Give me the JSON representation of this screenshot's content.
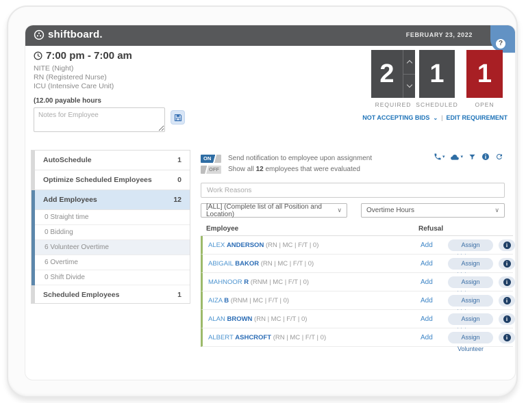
{
  "topbar": {
    "logo_text": "shiftboard.",
    "date": "FEBRUARY 23, 2022",
    "help_label": "?"
  },
  "shift": {
    "time_range": "7:00 pm - 7:00 am",
    "shift_type": "NITE (Night)",
    "position": "RN (Registered Nurse)",
    "unit": "ICU (Intensive Care Unit)",
    "payable_hours": "(12.00 payable hours",
    "notes_placeholder": "Notes for Employee"
  },
  "counters": {
    "required": {
      "value": "2",
      "label": "REQUIRED"
    },
    "scheduled": {
      "value": "1",
      "label": "SCHEDULED"
    },
    "open": {
      "value": "1",
      "label": "OPEN"
    },
    "bids_link": "NOT ACCEPTING BIDS",
    "bids_caret": "⌄",
    "separator": "|",
    "edit_link": "EDIT REQUIREMENT"
  },
  "sidebar": {
    "items": [
      {
        "label": "AutoSchedule",
        "count": "1"
      },
      {
        "label": "Optimize Scheduled Employees",
        "count": "0"
      },
      {
        "label": "Add Employees",
        "count": "12"
      }
    ],
    "subitems": [
      {
        "label": "0 Straight time",
        "highlight": false
      },
      {
        "label": "0 Bidding",
        "highlight": false
      },
      {
        "label": "6 Volunteer Overtime",
        "highlight": true
      },
      {
        "label": "6 Overtime",
        "highlight": false
      },
      {
        "label": "0 Shift Divide",
        "highlight": false
      }
    ],
    "footer": {
      "label": "Scheduled Employees",
      "count": "1"
    }
  },
  "panel": {
    "toggle_on_label": "ON",
    "toggle_off_label": "OFF",
    "notify_text": "Send notification to employee upon assignment",
    "show_prefix": "Show all ",
    "show_count": "12",
    "show_suffix": " employees that were evaluated",
    "caret": "▾",
    "work_reasons_placeholder": "Work Reasons",
    "position_filter": "[ALL] (Complete list of all Position and Location)",
    "overtime_filter": "Overtime Hours",
    "select_caret": "∨",
    "table": {
      "col_employee": "Employee",
      "col_refusal": "Refusal",
      "add_label": "Add",
      "assign_label": "Assign Volunteer",
      "info_label": "i",
      "rows": [
        {
          "first": "ALEX ",
          "last": "ANDERSON ",
          "details": "(RN | MC | F/T | 0)"
        },
        {
          "first": "ABIGAIL ",
          "last": "BAKOR ",
          "details": "(RN | MC | F/T | 0)"
        },
        {
          "first": "MAHNOOR ",
          "last": "R ",
          "details": "(RNM | MC | F/T | 0)"
        },
        {
          "first": "AIZA ",
          "last": "B ",
          "details": "(RNM | MC | F/T | 0)"
        },
        {
          "first": "ALAN ",
          "last": "BROWN ",
          "details": "(RN | MC | F/T | 0)"
        },
        {
          "first": "ALBERT ",
          "last": "ASHCROFT ",
          "details": "(RN | MC | F/T | 0)"
        }
      ]
    }
  },
  "colors": {
    "topbar": "#57585A",
    "counter_dark": "#4A4B4D",
    "counter_red": "#A81F24",
    "link_blue": "#1E73B8",
    "icon_blue": "#2E6DA4",
    "active_item_bg": "#D7E6F4",
    "row_green": "#9CBA6A",
    "pill_bg": "#E3E9F1",
    "info_navy": "#1F3F66"
  }
}
